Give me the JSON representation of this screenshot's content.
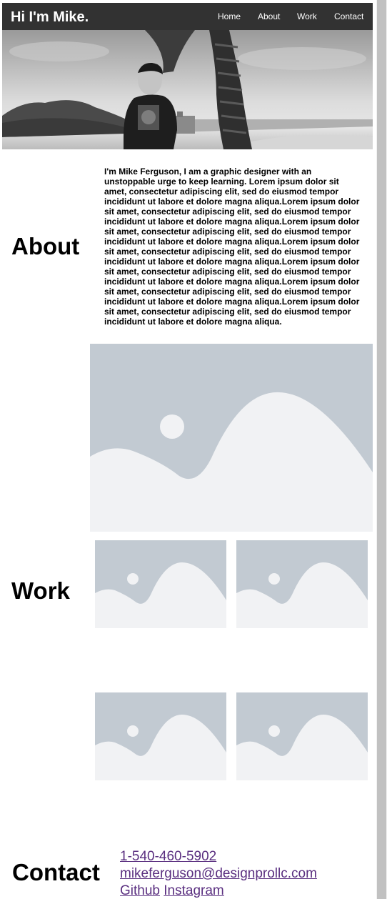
{
  "header": {
    "title": "Hi I'm Mike.",
    "nav": [
      "Home",
      "About",
      "Work",
      "Contact"
    ]
  },
  "hero": {
    "image": "photo-of-man-by-palm-tree"
  },
  "about": {
    "heading": "About",
    "text": "I'm Mike Ferguson, I am a graphic designer with an unstoppable urge to keep learning. Lorem ipsum dolor sit amet, consectetur adipiscing elit, sed do eiusmod tempor incididunt ut labore et dolore magna aliqua.Lorem ipsum dolor sit amet, consectetur adipiscing elit, sed do eiusmod tempor incididunt ut labore et dolore magna aliqua.Lorem ipsum dolor sit amet, consectetur adipiscing elit, sed do eiusmod tempor incididunt ut labore et dolore magna aliqua.Lorem ipsum dolor sit amet, consectetur adipiscing elit, sed do eiusmod tempor incididunt ut labore et dolore magna aliqua.Lorem ipsum dolor sit amet, consectetur adipiscing elit, sed do eiusmod tempor incididunt ut labore et dolore magna aliqua.Lorem ipsum dolor sit amet, consectetur adipiscing elit, sed do eiusmod tempor incididunt ut labore et dolore magna aliqua.Lorem ipsum dolor sit amet, consectetur adipiscing elit, sed do eiusmod tempor incididunt ut labore et dolore magna aliqua.",
    "image": "image-placeholder-icon"
  },
  "work": {
    "heading": "Work",
    "items": [
      "image-placeholder-icon",
      "image-placeholder-icon",
      "image-placeholder-icon",
      "image-placeholder-icon"
    ]
  },
  "contact": {
    "heading": "Contact",
    "phone": "1-540-460-5902",
    "email": "mikeferguson@designprollc.com",
    "github": "Github",
    "instagram": "Instagram"
  },
  "colors": {
    "header_bg": "#323232",
    "placeholder_bg": "#c2cad2",
    "placeholder_fg": "#f1f2f4",
    "link": "#5a2f80"
  }
}
